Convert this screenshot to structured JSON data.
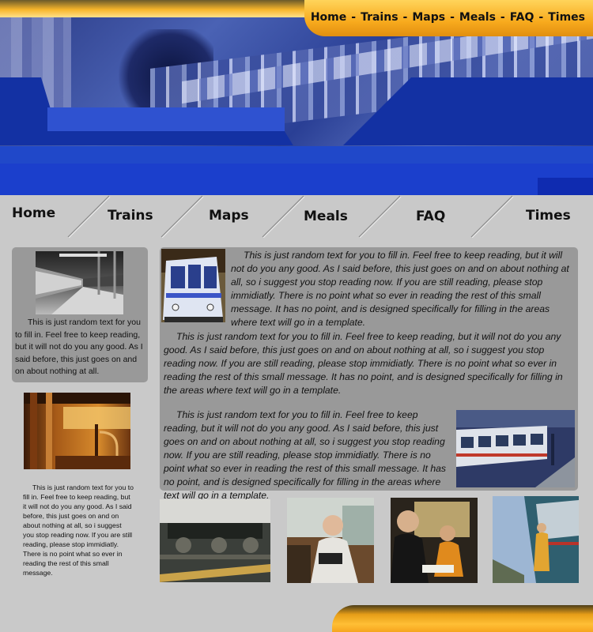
{
  "top_nav": {
    "items": [
      "Home",
      "Trains",
      "Maps",
      "Meals",
      "FAQ",
      "Times"
    ],
    "separator": "-"
  },
  "main_nav": {
    "items": [
      "Home",
      "Trains",
      "Maps",
      "Meals",
      "FAQ",
      "Times"
    ]
  },
  "left_panel": {
    "text": "This is just random text for you to fill in.  Feel free to keep reading, but it will not do you any good.  As I said before, this just goes on and on about nothing at all."
  },
  "left_text_2": "This is just random text for you to fill in.  Feel free to keep reading, but it will not do you any good.  As I said before, this just goes on and on about nothing at all, so i suggest you stop reading now.  If you are still reading, please stop immidiatly.  There is no point what so ever in reading the rest of this small message.",
  "main_panel": {
    "paragraphs": [
      "This is just random text for you to fill in.  Feel free to keep reading, but it will not do you any good.  As I said before, this just goes on and on about nothing at all, so i suggest you stop reading now.  If you are still reading, please stop immidiatly.  There is no point what so ever in reading the rest of this small message.  It has no point, and is designed specifically for filling in the areas where text will go in a template.",
      "This is just random text for you to fill in.  Feel free to keep reading, but it will not do you any good.  As I said before, this just goes on and on about nothing at all, so i suggest you stop reading now.  If you are still reading, please stop immidiatly.  There is no point what so ever in reading the rest of this small message.  It has no point, and is designed specifically for filling in the areas where text will go in a template.",
      "This is just random text for you to fill in.  Feel free to keep reading, but it will not do you any good.  As I said before, this just goes on and on about nothing at all, so i suggest you stop reading now.  If you are still reading, please stop immidiatly.  There is no point what so ever in reading the rest of this small message.  It has no point, and is designed specifically for filling in the areas where text will go in a template."
    ]
  },
  "colors": {
    "header_blue": "#1d3fb8",
    "orange_accent": "#f8aa1d",
    "panel_gray": "#999999",
    "page_gray": "#c9c9c9"
  }
}
